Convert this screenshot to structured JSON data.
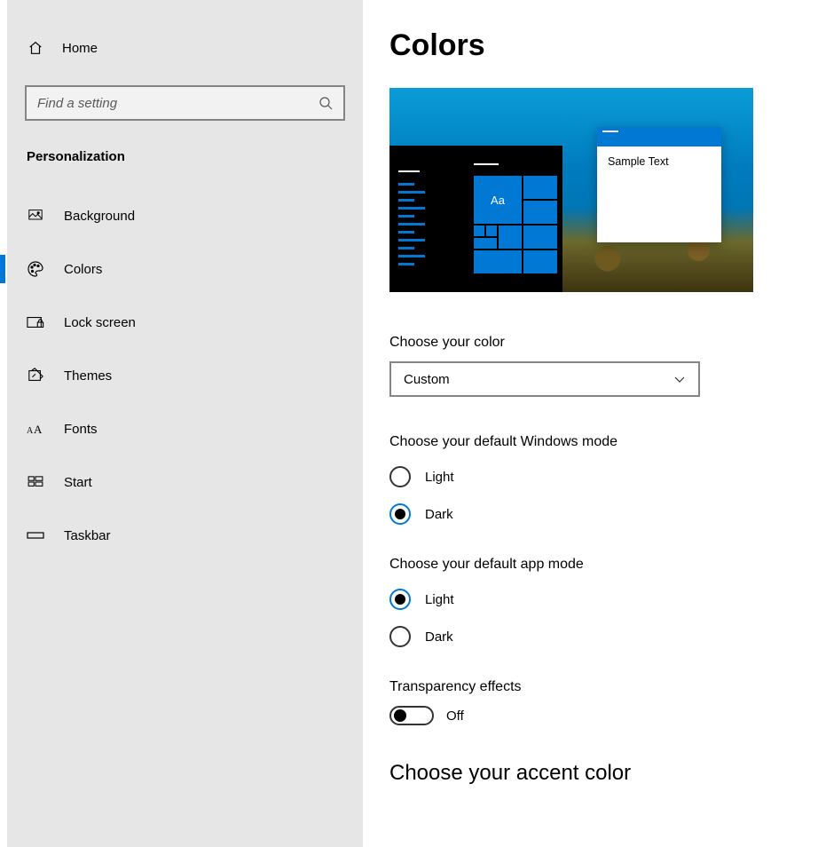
{
  "sidebar": {
    "home_label": "Home",
    "search_placeholder": "Find a setting",
    "category": "Personalization",
    "items": [
      {
        "label": "Background"
      },
      {
        "label": "Colors"
      },
      {
        "label": "Lock screen"
      },
      {
        "label": "Themes"
      },
      {
        "label": "Fonts"
      },
      {
        "label": "Start"
      },
      {
        "label": "Taskbar"
      }
    ]
  },
  "main": {
    "title": "Colors",
    "preview_sample_text": "Sample Text",
    "preview_tile_aa": "Aa",
    "choose_color_label": "Choose your color",
    "choose_color_value": "Custom",
    "windows_mode_label": "Choose your default Windows mode",
    "windows_mode_options": {
      "light": "Light",
      "dark": "Dark"
    },
    "windows_mode_selected": "dark",
    "app_mode_label": "Choose your default app mode",
    "app_mode_options": {
      "light": "Light",
      "dark": "Dark"
    },
    "app_mode_selected": "light",
    "transparency_label": "Transparency effects",
    "transparency_value": "Off",
    "accent_heading": "Choose your accent color"
  }
}
